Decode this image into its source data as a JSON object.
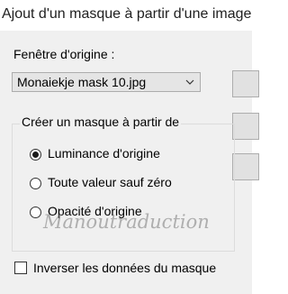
{
  "window": {
    "title": "Ajout d'un masque à partir d'une image"
  },
  "source_window": {
    "label": "Fenêtre d'origine :",
    "selected": "Monaiekje mask 10.jpg"
  },
  "mask_group": {
    "legend": "Créer un masque à partir de",
    "options": [
      {
        "label": "Luminance d'origine",
        "checked": true
      },
      {
        "label": "Toute valeur sauf zéro",
        "checked": false
      },
      {
        "label": "Opacité d'origine",
        "checked": false
      }
    ]
  },
  "invert": {
    "label": "Inverser les données du masque",
    "checked": false
  },
  "watermark": "Manoutraduction"
}
